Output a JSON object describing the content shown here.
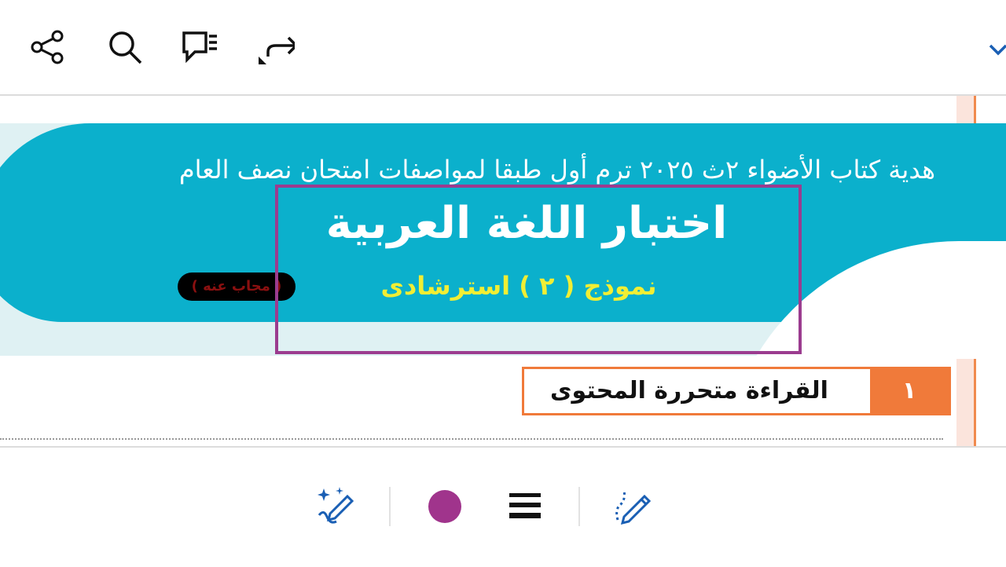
{
  "toolbar": {
    "icons": [
      "share-icon",
      "search-icon",
      "comments-icon",
      "redo-icon",
      "chevron-down-icon"
    ]
  },
  "document": {
    "subtitle": "هدية كتاب الأضواء ٢ث ٢٠٢٥ ترم أول طبقا لمواصفات امتحان نصف العام",
    "title": "اختبار اللغة العربية",
    "model_label": "نموذج ( ٢ ) استرشادى",
    "answered_badge": "( مجاب عنه )",
    "section_number": "١",
    "section_title": "القراءة متحررة المحتوى"
  },
  "drawing_toolbar": {
    "icons": [
      "magic-pen-icon",
      "stroke-width-icon",
      "pen-icon"
    ],
    "selected_color": "#a0348c"
  },
  "colors": {
    "banner_teal": "#0bb0cc",
    "banner_light": "#dff1f3",
    "highlight": "#9b3c8f",
    "section_orange": "#f07a3a",
    "model_yellow": "#f1ee34",
    "icon_blue": "#1a5fb4"
  }
}
